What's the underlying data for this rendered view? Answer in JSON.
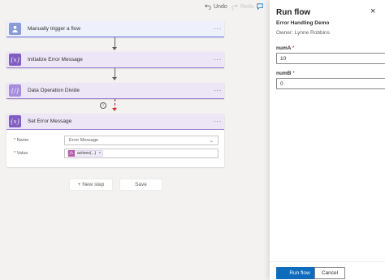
{
  "toolbar": {
    "undo_label": "Undo",
    "redo_label": "Redo",
    "comment_icon": "comment-icon"
  },
  "flow_steps": [
    {
      "title": "Manually trigger a flow",
      "icon": "person-icon"
    },
    {
      "title": "Initialize Error Message",
      "icon": "variable-icon"
    },
    {
      "title": "Data Operation Divide",
      "icon": "expression-icon"
    },
    {
      "title": "Set Error Message",
      "icon": "variable-icon"
    }
  ],
  "more_glyph": "···",
  "set_error_message": {
    "name_label": "* Name",
    "name_value": "Error Message",
    "value_label": "* Value",
    "token_text": "actions(...)",
    "token_remove": "×"
  },
  "canvas_buttons": {
    "new_step": "+ New step",
    "save": "Save"
  },
  "panel": {
    "title": "Run flow",
    "close": "×",
    "flow_name": "Error Handling Demo",
    "owner": "Owner: Lynne Robbins",
    "fields": [
      {
        "label": "numA",
        "value": "10"
      },
      {
        "label": "numB",
        "value": "0"
      }
    ],
    "required_mark": "*",
    "run_button": "Run flow",
    "cancel_button": "Cancel"
  },
  "colors": {
    "accent": "#0f6cbd",
    "trigger": "#8a9bd6",
    "variable": "#7f5dc2",
    "token": "#b45ca9"
  }
}
